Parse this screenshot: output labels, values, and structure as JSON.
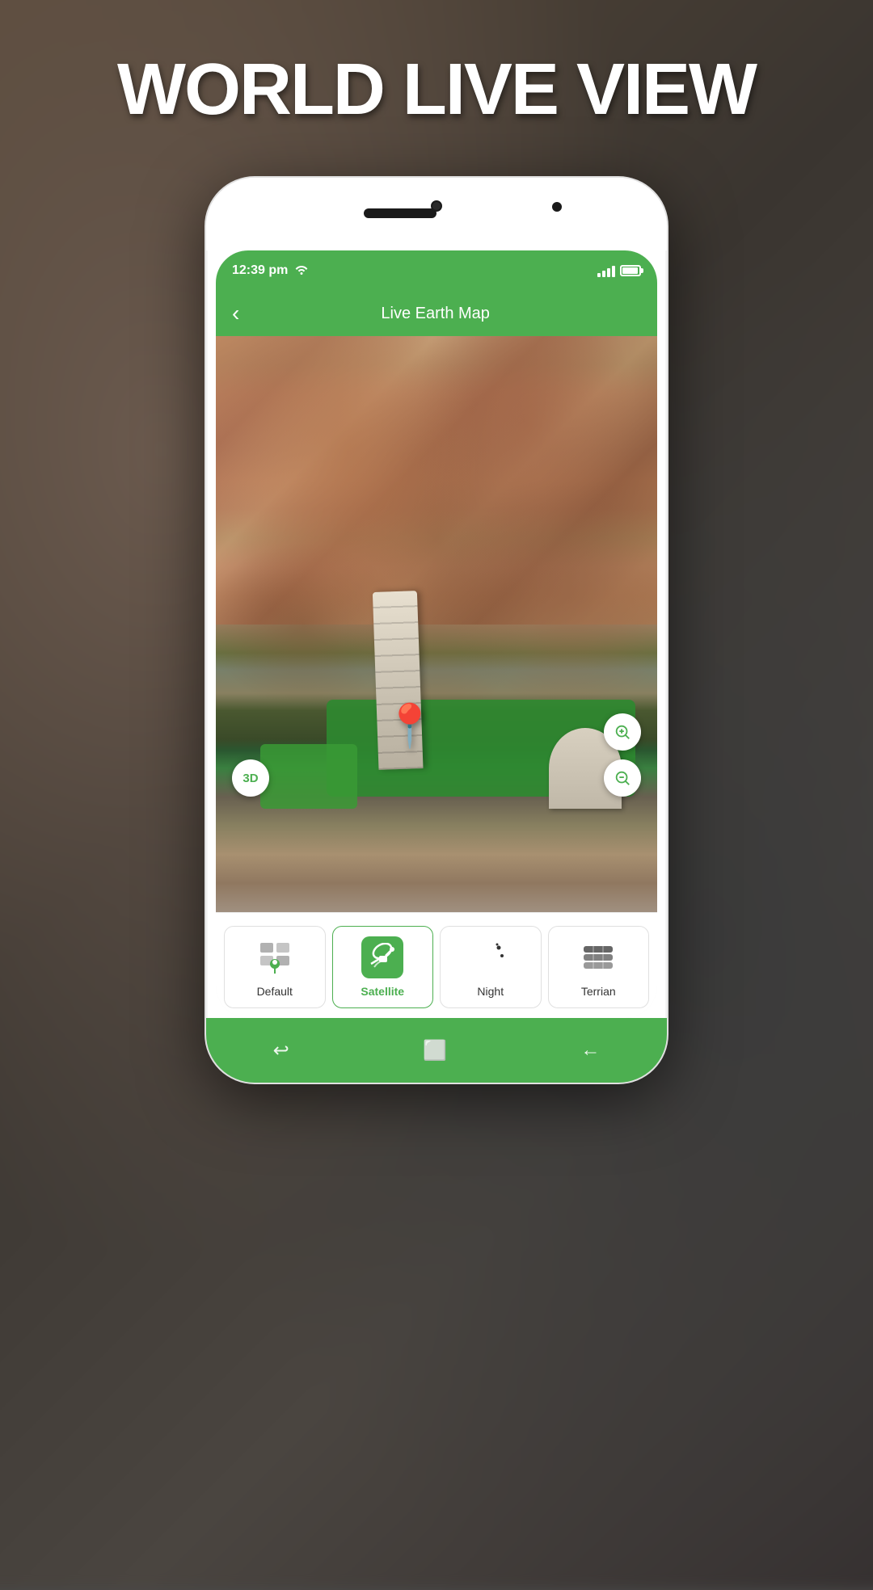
{
  "app": {
    "title": "WORLD LIVE VIEW",
    "background_color": "#4a4a4a"
  },
  "status_bar": {
    "time": "12:39 pm",
    "wifi": true,
    "signal_bars": 4,
    "battery": 90
  },
  "header": {
    "title": "Live Earth Map",
    "back_label": "‹"
  },
  "map": {
    "view_type": "satellite",
    "location": "Tower of Pisa, Italy",
    "zoom_in_label": "🔍",
    "zoom_out_label": "🔍",
    "btn_3d_label": "3D"
  },
  "tabs": [
    {
      "id": "default",
      "label": "Default",
      "icon": "map-pin-icon",
      "active": false
    },
    {
      "id": "satellite",
      "label": "Satellite",
      "icon": "satellite-icon",
      "active": true
    },
    {
      "id": "night",
      "label": "Night",
      "icon": "night-icon",
      "active": false
    },
    {
      "id": "terrain",
      "label": "Terrian",
      "icon": "terrain-icon",
      "active": false
    }
  ],
  "nav_bar": {
    "back_icon": "↩",
    "home_icon": "⬜",
    "return_icon": "←"
  }
}
